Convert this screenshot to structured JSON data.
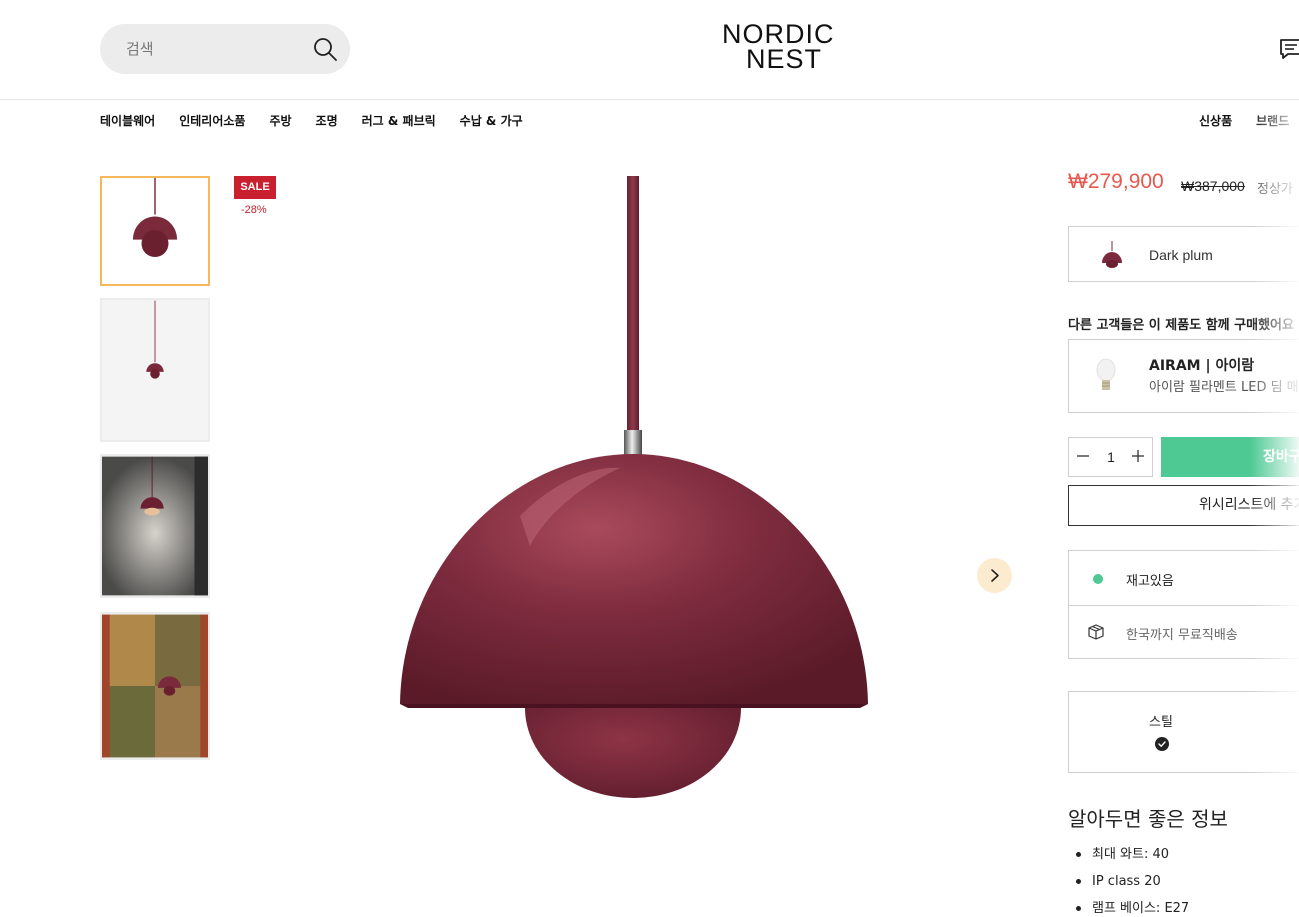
{
  "header": {
    "search_placeholder": "검색",
    "logo_line1": "NORDIC",
    "logo_line2": "NEST"
  },
  "nav": {
    "left": [
      "테이블웨어",
      "인테리어소품",
      "주방",
      "조명",
      "러그 & 패브릭",
      "수납 & 가구"
    ],
    "right": [
      "신상품",
      "브랜드"
    ]
  },
  "product": {
    "sale_badge": "SALE",
    "discount": "-28%",
    "price": "₩279,900",
    "old_price": "₩387,000",
    "regular_label": "정상가",
    "variant": "Dark plum",
    "also_bought_heading": "다른 고객들은 이 제품도 함께 구매했어요",
    "recommendation": {
      "brand": "AIRAM | 아이람",
      "description": "아이람 필라멘트 LED 딤 매"
    },
    "quantity": "1",
    "cart_label": "장바구니",
    "wishlist_label": "위시리스트에 추가",
    "stock_text": "재고있음",
    "shipping_text": "한국까지 무료직배송",
    "material_label": "스틸",
    "info_title": "알아두면 좋은 정보",
    "info_items": [
      "최대 와트: 40",
      "IP class 20",
      "램프 베이스: E27"
    ]
  },
  "colors": {
    "accent_green": "#4ec993",
    "sale_red": "#c8202f",
    "price_red": "#e8574d",
    "lamp_plum": "#7a2a3a",
    "active_thumb_border": "#f5b95c"
  },
  "icons": {
    "search": "search-icon",
    "chat": "chat-icon",
    "next": "chevron-right-icon",
    "shipping": "box-icon",
    "check": "check-circle-icon"
  }
}
